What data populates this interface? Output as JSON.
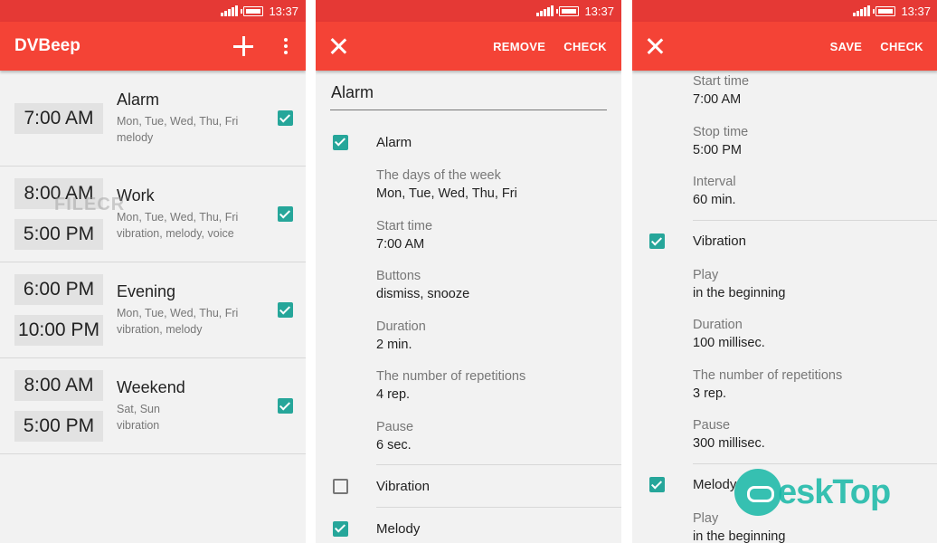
{
  "status": {
    "time": "13:37"
  },
  "panel1": {
    "title": "DVBeep",
    "alarms": [
      {
        "times": [
          "7:00 AM"
        ],
        "name": "Alarm",
        "days": "Mon, Tue, Wed, Thu, Fri",
        "sounds": "melody",
        "checked": true
      },
      {
        "times": [
          "8:00 AM",
          "5:00 PM"
        ],
        "name": "Work",
        "days": "Mon, Tue, Wed, Thu, Fri",
        "sounds": "vibration, melody, voice",
        "checked": true
      },
      {
        "times": [
          "6:00 PM",
          "10:00 PM"
        ],
        "name": "Evening",
        "days": "Mon, Tue, Wed, Thu, Fri",
        "sounds": "vibration, melody",
        "checked": true
      },
      {
        "times": [
          "8:00 AM",
          "5:00 PM"
        ],
        "name": "Weekend",
        "days": "Sat, Sun",
        "sounds": "vibration",
        "checked": true
      }
    ],
    "watermark": "FILECR"
  },
  "panel2": {
    "remove_label": "REMOVE",
    "check_label": "CHECK",
    "name_value": "Alarm",
    "alarm_label": "Alarm",
    "settings": [
      {
        "k": "The days of the week",
        "v": "Mon, Tue, Wed, Thu, Fri"
      },
      {
        "k": "Start time",
        "v": "7:00 AM"
      },
      {
        "k": "Buttons",
        "v": "dismiss, snooze"
      },
      {
        "k": "Duration",
        "v": "2 min."
      },
      {
        "k": "The number of repetitions",
        "v": "4 rep."
      },
      {
        "k": "Pause",
        "v": "6 sec."
      }
    ],
    "vibration_label": "Vibration",
    "melody_label": "Melody"
  },
  "panel3": {
    "save_label": "SAVE",
    "check_label": "CHECK",
    "top_settings": [
      {
        "k": "Start time",
        "v": "7:00 AM"
      },
      {
        "k": "Stop time",
        "v": "5:00 PM"
      },
      {
        "k": "Interval",
        "v": "60 min."
      }
    ],
    "vibration_label": "Vibration",
    "vibration_settings": [
      {
        "k": "Play",
        "v": "in the beginning"
      },
      {
        "k": "Duration",
        "v": "100 millisec."
      },
      {
        "k": "The number of repetitions",
        "v": "3 rep."
      },
      {
        "k": "Pause",
        "v": "300 millisec."
      }
    ],
    "melody_label": "Melody",
    "melody_settings": [
      {
        "k": "Play",
        "v": "in the beginning"
      }
    ]
  },
  "brand": "esk",
  "brand_text": "eskTop",
  "colors": {
    "toolbar": "#f44336",
    "statusbar": "#e53935",
    "checkbox": "#26a69a"
  }
}
